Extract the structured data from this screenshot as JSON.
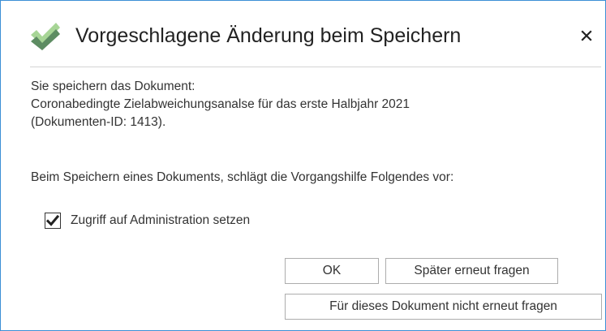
{
  "dialog": {
    "title": "Vorgeschlagene Änderung beim Speichern",
    "close_icon": "close-icon",
    "app_icon": "green-check-icon"
  },
  "body": {
    "line1": "Sie speichern das Dokument:",
    "line2": "Coronabedingte Zielabweichungsanalse für das erste Halbjahr 2021",
    "line3": "(Dokumenten-ID: 1413).",
    "line4": "Beim Speichern eines Dokuments, schlägt die Vorgangshilfe Folgendes vor:"
  },
  "option": {
    "label": "Zugriff auf Administration setzen",
    "checked": true
  },
  "buttons": {
    "ok": "OK",
    "later": "Später erneut fragen",
    "never": "Für dieses Dokument nicht erneut fragen"
  },
  "colors": {
    "border": "#3c8fd6",
    "check_light": "#9bd08a",
    "check_dark": "#5a8a5a"
  }
}
